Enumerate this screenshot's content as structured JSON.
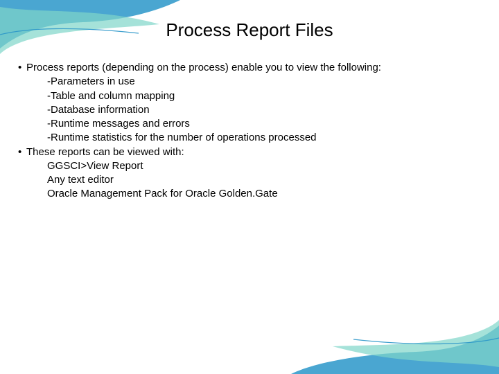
{
  "title": "Process Report Files",
  "bullets": [
    {
      "text": "Process reports (depending on the process) enable you to view the following:",
      "subs": [
        "-Parameters in use",
        "-Table and column mapping",
        "-Database information",
        "-Runtime messages and errors",
        "-Runtime statistics for the number of operations processed"
      ]
    },
    {
      "text": "These reports can be viewed with:",
      "subs": [
        "GGSCI>View Report",
        "Any text editor",
        "Oracle Management Pack for Oracle Golden.Gate"
      ]
    }
  ]
}
